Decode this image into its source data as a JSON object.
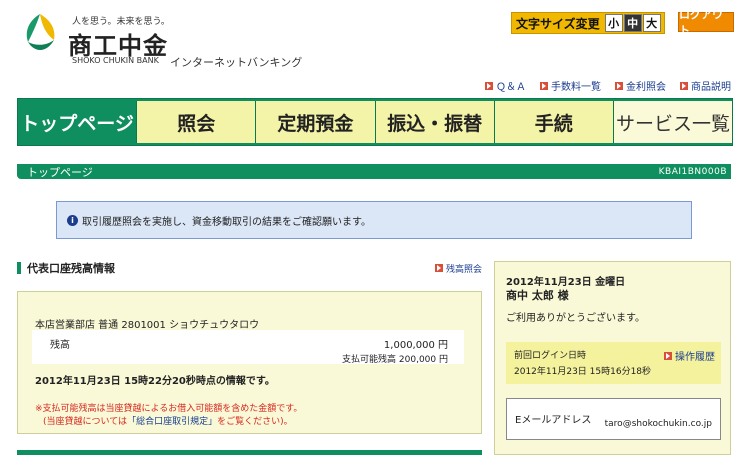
{
  "header": {
    "tagline": "人を思う。未来を思う。",
    "bank_name": "商工中金",
    "bank_name_en": "SHOKO CHUKIN BANK",
    "service_name": "インターネットバンキング",
    "font_size": {
      "label": "文字サイズ変更",
      "small": "小",
      "medium": "中",
      "large": "大",
      "selected": "中"
    },
    "logout_label": "ログアウト"
  },
  "util_nav": [
    "Ｑ＆Ａ",
    "手数料一覧",
    "金利照会",
    "商品説明"
  ],
  "global_nav": [
    "トップページ",
    "照会",
    "定期預金",
    "振込・振替",
    "手続",
    "サービス一覧"
  ],
  "page": {
    "title": "トップページ",
    "screen_id": "KBAI1BN000B"
  },
  "info_message": "取引履歴照会を実施し、資金移動取引の結果をご確認願います。",
  "account_section": {
    "heading": "代表口座残高情報",
    "link": "残高照会",
    "account_line": "本店営業部店 普通 2801001 ショウチュウタロウ",
    "balance_label": "残高",
    "balance_value": "1,000,000 円",
    "available_label": "支払可能残高",
    "available_value": "200,000 円",
    "as_of": "2012年11月23日 15時22分20秒時点の情報です。",
    "note1": "※支払可能残高は当座貸越によるお借入可能額を含めた金額です。",
    "note2_prefix": "(当座貸越については",
    "note2_link": "「総合口座取引規定」",
    "note2_suffix": "をご覧ください)。"
  },
  "side_panel": {
    "date": "2012年11月23日 金曜日",
    "user": "商中 太郎 様",
    "thanks": "ご利用ありがとうございます。",
    "last_login_label": "前回ログイン日時",
    "history_link": "操作履歴",
    "last_login_value": "2012年11月23日 15時16分18秒",
    "email_label": "Eメールアドレス",
    "email_value": "taro@shokochukin.co.jp"
  },
  "colors": {
    "primary_green": "#0f8f5f",
    "nav_yellow": "#f4f4a8",
    "accent_orange": "#f08a00",
    "note_red": "#d8281e"
  }
}
